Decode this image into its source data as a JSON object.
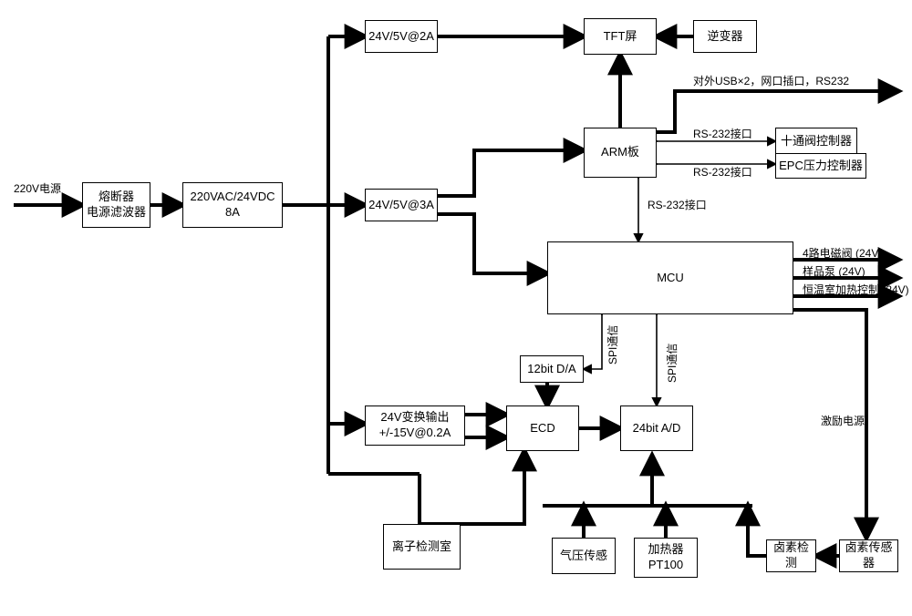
{
  "input_power": "220V电源",
  "fuse_filter": "熔断器\n电源滤波器",
  "psu": "220VAC/24VDC\n8A",
  "reg_2a": "24V/5V@2A",
  "reg_3a": "24V/5V@3A",
  "reg_15v": "24V变换输出\n+/-15V@0.2A",
  "tft": "TFT屏",
  "inverter": "逆变器",
  "arm": "ARM板",
  "mcu": "MCU",
  "dac": "12bit D/A",
  "ecd": "ECD",
  "adc": "24bit A/D",
  "ion_chamber": "离子检测室",
  "pressure_sensor": "气压传感",
  "heater": "加热器\nPT100",
  "halogen_det": "卤素检测",
  "halogen_sensor": "卤素传感器",
  "ten_valve": "十通阀控制器",
  "epc": "EPC压力控制器",
  "lbl_usb": "对外USB×2，网口插口，RS232",
  "lbl_rs232_a": "RS-232接口",
  "lbl_rs232_b": "RS-232接口",
  "lbl_rs232_c": "RS-232接口",
  "lbl_spi_a": "SPI通信",
  "lbl_spi_b": "SPI通信",
  "lbl_out1": "4路电磁阀 (24V)",
  "lbl_out2": "样品泵 (24V)",
  "lbl_out3": "恒温室加热控制 (24V)",
  "lbl_excite": "激励电源"
}
